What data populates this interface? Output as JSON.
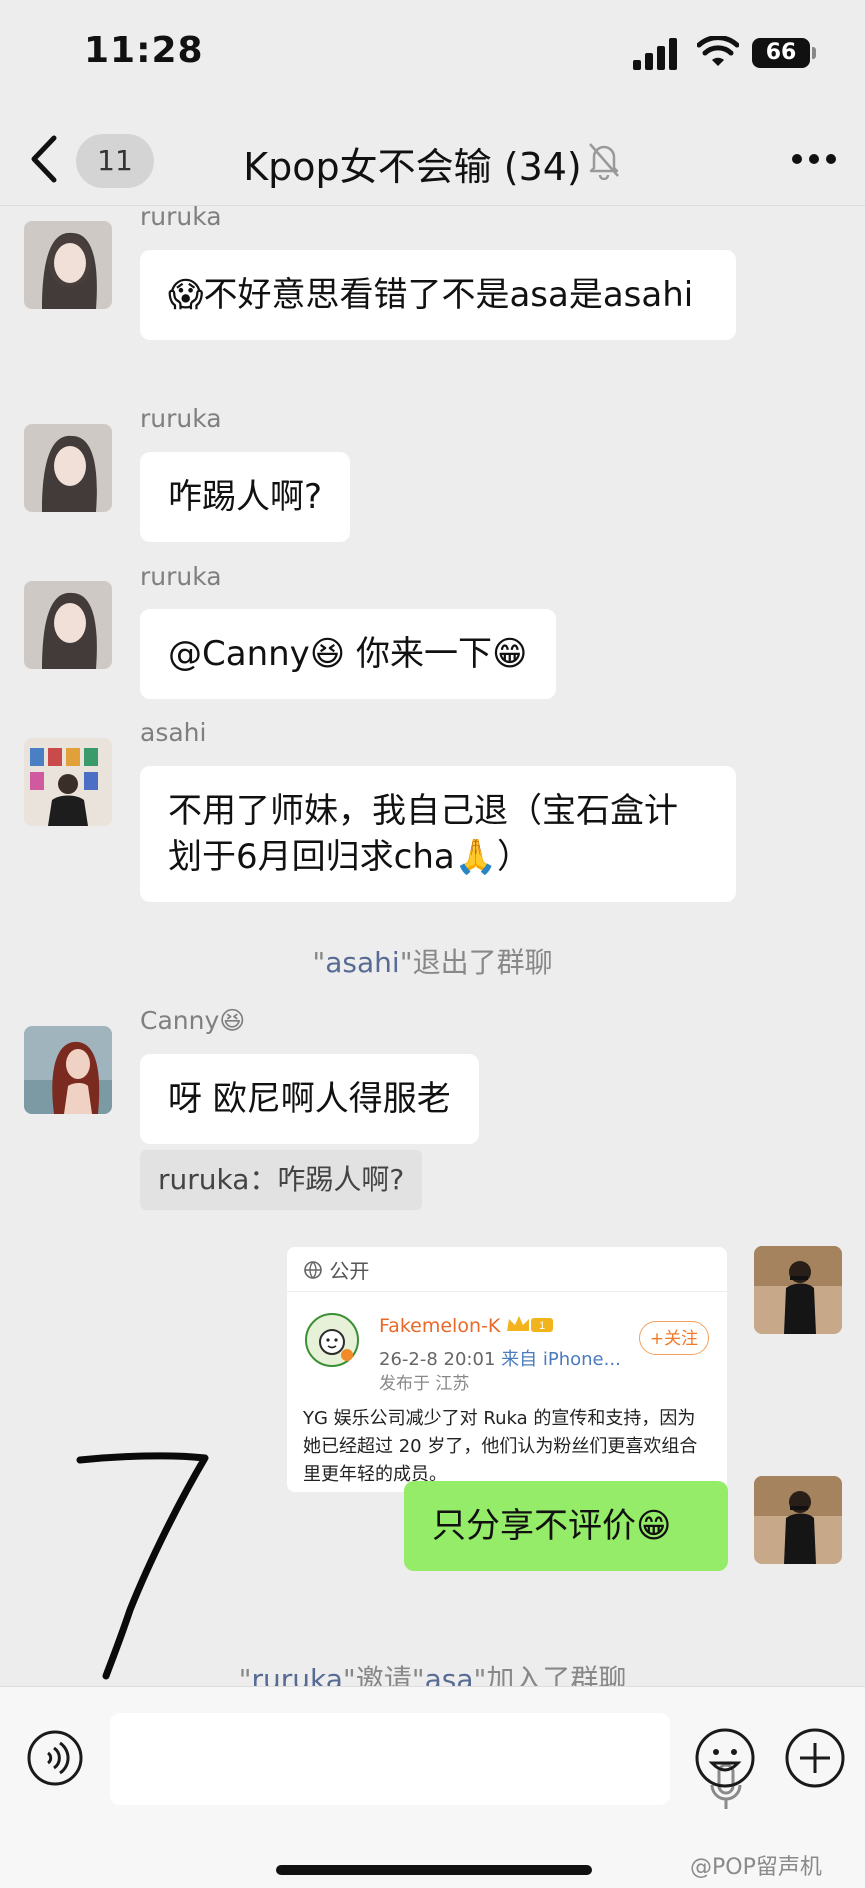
{
  "status_bar": {
    "time": "11:28",
    "battery": "66",
    "signal_icon": "cellular-signal-icon",
    "wifi_icon": "wifi-icon"
  },
  "header": {
    "unread_count": "11",
    "title": "Kpop女不会输 (34)",
    "muted_icon": "bell-muted-icon",
    "more_icon": "more-icon",
    "back_icon": "back-chevron-icon"
  },
  "messages": [
    {
      "sender": "ruruka",
      "text": "😱不好意思看错了不是asa是asahi"
    },
    {
      "sender": "ruruka",
      "text": "咋踢人啊?"
    },
    {
      "sender": "ruruka",
      "text": "@Canny😆 你来一下😁"
    },
    {
      "sender": "asahi",
      "text": "不用了师妹，我自己退（宝石盒计划于6月回归求cha🙏）"
    },
    {
      "sender": "Canny😆",
      "text": "呀 欧尼啊人得服老"
    },
    {
      "text": "只分享不评价😁"
    }
  ],
  "system": {
    "left": {
      "q1": "\"",
      "name": "asahi",
      "q2": "\"",
      "tail": "退出了群聊"
    },
    "invite": {
      "q1": "\"",
      "name1": "ruruka",
      "mid": "\"邀请\"",
      "name2": "asa",
      "tail": "\"加入了群聊"
    }
  },
  "quote": "ruruka：咋踢人啊?",
  "weibo_card": {
    "visibility": "公开",
    "author": "Fakemelon-K",
    "follow": "+关注",
    "date": "26-2-8 20:01",
    "device": "来自 iPhone...",
    "location": "发布于 江苏",
    "body": "YG 娱乐公司减少了对 Ruka 的宣传和支持，因为她已经超过 20 岁了，他们认为粉丝们更喜欢组合里更年轻的成员。"
  },
  "composer": {
    "voice_icon": "voice-icon",
    "mic_icon": "mic-icon",
    "emoji_icon": "emoji-icon",
    "plus_icon": "plus-icon"
  },
  "watermark": "@POP留声机",
  "colors": {
    "background": "#ededed",
    "bubble_self": "#95ec69",
    "bubble_other": "#ffffff",
    "name_link": "#576b95",
    "weibo_name": "#e86a2a"
  }
}
